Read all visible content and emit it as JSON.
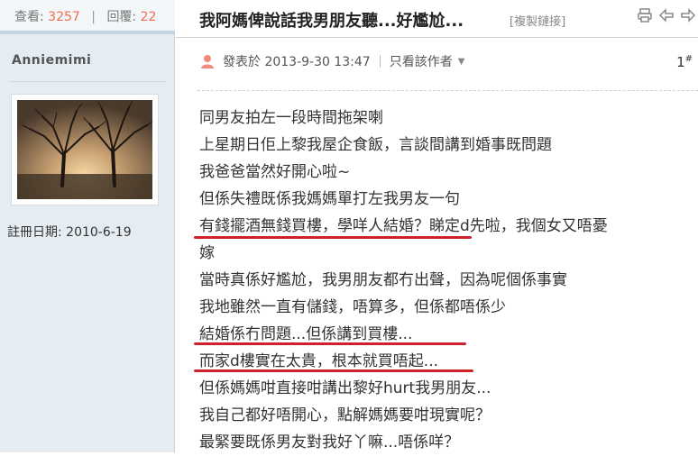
{
  "stats": {
    "views_label": "查看:",
    "views": "3257",
    "separator": "|",
    "replies_label": "回覆:",
    "replies": "22"
  },
  "author": {
    "name": "Anniemimi"
  },
  "profile": {
    "reg_date": "註冊日期: 2010-6-19"
  },
  "thread": {
    "title": "我阿媽俾說話我男朋友聽...好尷尬...",
    "copy_link": "[複製鏈接]"
  },
  "post": {
    "posted_at": "發表於 2013-9-30 13:47",
    "only_author": "只看該作者",
    "floor": "1",
    "floor_mark": "#",
    "lines": [
      "同男友拍左一段時間拖架喇",
      "上星期日佢上黎我屋企食飯，言談間講到婚事既問題",
      "我爸爸當然好開心啦~",
      "但係失禮既係我媽媽單打左我男友一句",
      "有錢擺酒無錢買樓，學咩人結婚？睇定d先啦，我個女又唔憂",
      "嫁",
      "當時真係好尷尬，我男朋友都冇出聲，因為呢個係事實",
      "我地雖然一直有儲錢，唔算多，但係都唔係少",
      "結婚係冇問題...但係講到買樓...",
      "而家d樓實在太貴，根本就買唔起...",
      "但係媽媽咁直接咁講出黎好hurt我男朋友...",
      "我自己都好唔開心，點解媽媽要咁現實呢？",
      "最緊要既係男友對我好丫嘛...唔係咩？"
    ]
  },
  "colors": {
    "accent": "#f26c4f",
    "underline": "#d0202a",
    "sidebar_bg": "#e5edf2"
  }
}
